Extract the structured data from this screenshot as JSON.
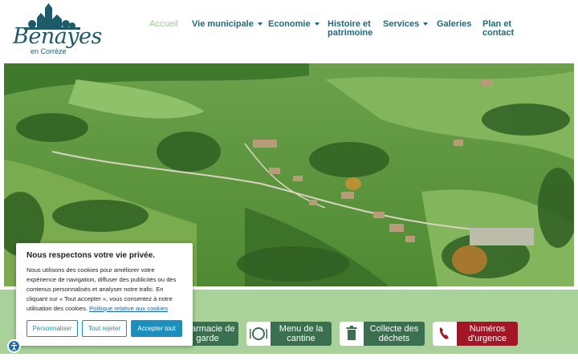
{
  "site": {
    "logo_title": "Benayes",
    "logo_subtitle": "en Corrèze"
  },
  "nav": [
    {
      "label": "Accueil",
      "active": true,
      "dropdown": false
    },
    {
      "label": "Vie municipale",
      "active": false,
      "dropdown": true
    },
    {
      "label": "Economie",
      "active": false,
      "dropdown": true
    },
    {
      "label": "Histoire et patrimoine",
      "active": false,
      "dropdown": false
    },
    {
      "label": "Services",
      "active": false,
      "dropdown": true
    },
    {
      "label": "Galeries",
      "active": false,
      "dropdown": false
    },
    {
      "label": "Plan et contact",
      "active": false,
      "dropdown": false
    }
  ],
  "hero": {
    "icon": "aerial-village-photo"
  },
  "quick_links": [
    {
      "label": "Pharmacie de garde",
      "icon": "pharmacy-icon",
      "color": "#3a6f4f"
    },
    {
      "label": "Menu de la cantine",
      "icon": "plate-icon",
      "color": "#3a6f4f"
    },
    {
      "label": "Collecte des déchets",
      "icon": "trash-icon",
      "color": "#3a6f4f"
    },
    {
      "label": "Numéros d'urgence",
      "icon": "phone-icon",
      "color": "#a41626"
    }
  ],
  "cookie": {
    "title": "Nous respectons votre vie privée.",
    "text": "Nous utilisons des cookies pour améliorer votre expérience de navigation, diffuser des publicités ou des contenus personnalisés et analyser notre trafic. En cliquant sur « Tout accepter », vous consentez à notre utilisation des cookies.",
    "link": "Politique relative aux cookies",
    "btn_customize": "Personnaliser",
    "btn_reject": "Tout rejeter",
    "btn_accept": "Accepter tout"
  },
  "colors": {
    "brand": "#1e6a7b",
    "active_nav": "#9cc88f",
    "band": "#a8d29a",
    "accent": "#1d8fbf",
    "urgent": "#a41626"
  }
}
